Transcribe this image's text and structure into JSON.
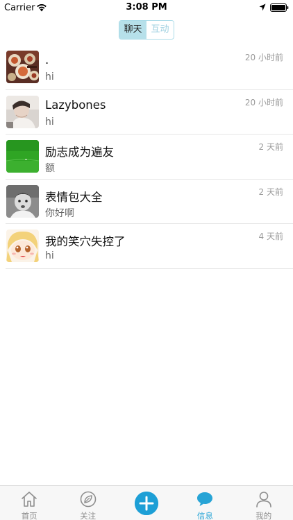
{
  "status_bar": {
    "carrier": "Carrier",
    "time": "3:08 PM"
  },
  "segments": [
    {
      "label": "聊天",
      "active": true
    },
    {
      "label": "互动",
      "active": false
    }
  ],
  "conversations": [
    {
      "name": ".",
      "message": "hi",
      "time": "20 小时前",
      "avatar_icon": "food-photo-avatar"
    },
    {
      "name": "Lazybones",
      "message": "hi",
      "time": "20 小时前",
      "avatar_icon": "person-photo-avatar"
    },
    {
      "name": "励志成为遍友",
      "message": "额",
      "time": "2 天前",
      "avatar_icon": "green-field-avatar"
    },
    {
      "name": "表情包大全",
      "message": "你好啊",
      "time": "2 天前",
      "avatar_icon": "baby-photo-avatar"
    },
    {
      "name": "我的笑穴失控了",
      "message": "hi",
      "time": "4 天前",
      "avatar_icon": "anime-girl-avatar"
    }
  ],
  "tab_bar": {
    "home": "首页",
    "follow": "关注",
    "messages": "信息",
    "mine": "我的",
    "active": "messages",
    "accent_color": "#27a4d6"
  }
}
